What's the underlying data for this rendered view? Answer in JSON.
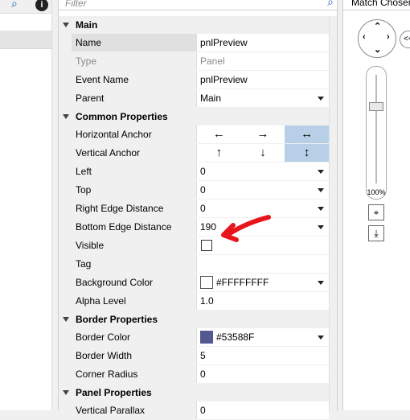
{
  "filter": {
    "placeholder": "Filter"
  },
  "right_panel": {
    "title": "Match Chosen",
    "zoom_label": "100%",
    "back_label": "<<"
  },
  "left_panel": {
    "info_label": "i"
  },
  "categories": {
    "main": "Main",
    "common": "Common Properties",
    "border": "Border Properties",
    "panel": "Panel Properties"
  },
  "props": {
    "name": {
      "label": "Name",
      "value": "pnlPreview"
    },
    "type": {
      "label": "Type",
      "value": "Panel"
    },
    "event_name": {
      "label": "Event Name",
      "value": "pnlPreview"
    },
    "parent": {
      "label": "Parent",
      "value": "Main"
    },
    "h_anchor": {
      "label": "Horizontal Anchor",
      "options": [
        "←",
        "→",
        "↔"
      ],
      "selected": "↔"
    },
    "v_anchor": {
      "label": "Vertical Anchor",
      "options": [
        "↑",
        "↓",
        "↕"
      ],
      "selected": "↕"
    },
    "left": {
      "label": "Left",
      "value": "0"
    },
    "top": {
      "label": "Top",
      "value": "0"
    },
    "right_edge": {
      "label": "Right Edge Distance",
      "value": "0"
    },
    "bottom_edge": {
      "label": "Bottom Edge Distance",
      "value": "190"
    },
    "visible": {
      "label": "Visible",
      "checked": false
    },
    "tag": {
      "label": "Tag",
      "value": ""
    },
    "bg_color": {
      "label": "Background Color",
      "value": "#FFFFFFFF",
      "swatch": "#ffffff"
    },
    "alpha": {
      "label": "Alpha Level",
      "value": "1.0"
    },
    "border_color": {
      "label": "Border Color",
      "value": "#53588F",
      "swatch": "#53588f"
    },
    "border_width": {
      "label": "Border Width",
      "value": "5"
    },
    "corner_radius": {
      "label": "Corner Radius",
      "value": "0"
    },
    "v_parallax": {
      "label": "Vertical Parallax",
      "value": "0"
    }
  },
  "colors": {
    "annotation": "#e8151b",
    "anchor_selected": "#b7d0e8"
  }
}
